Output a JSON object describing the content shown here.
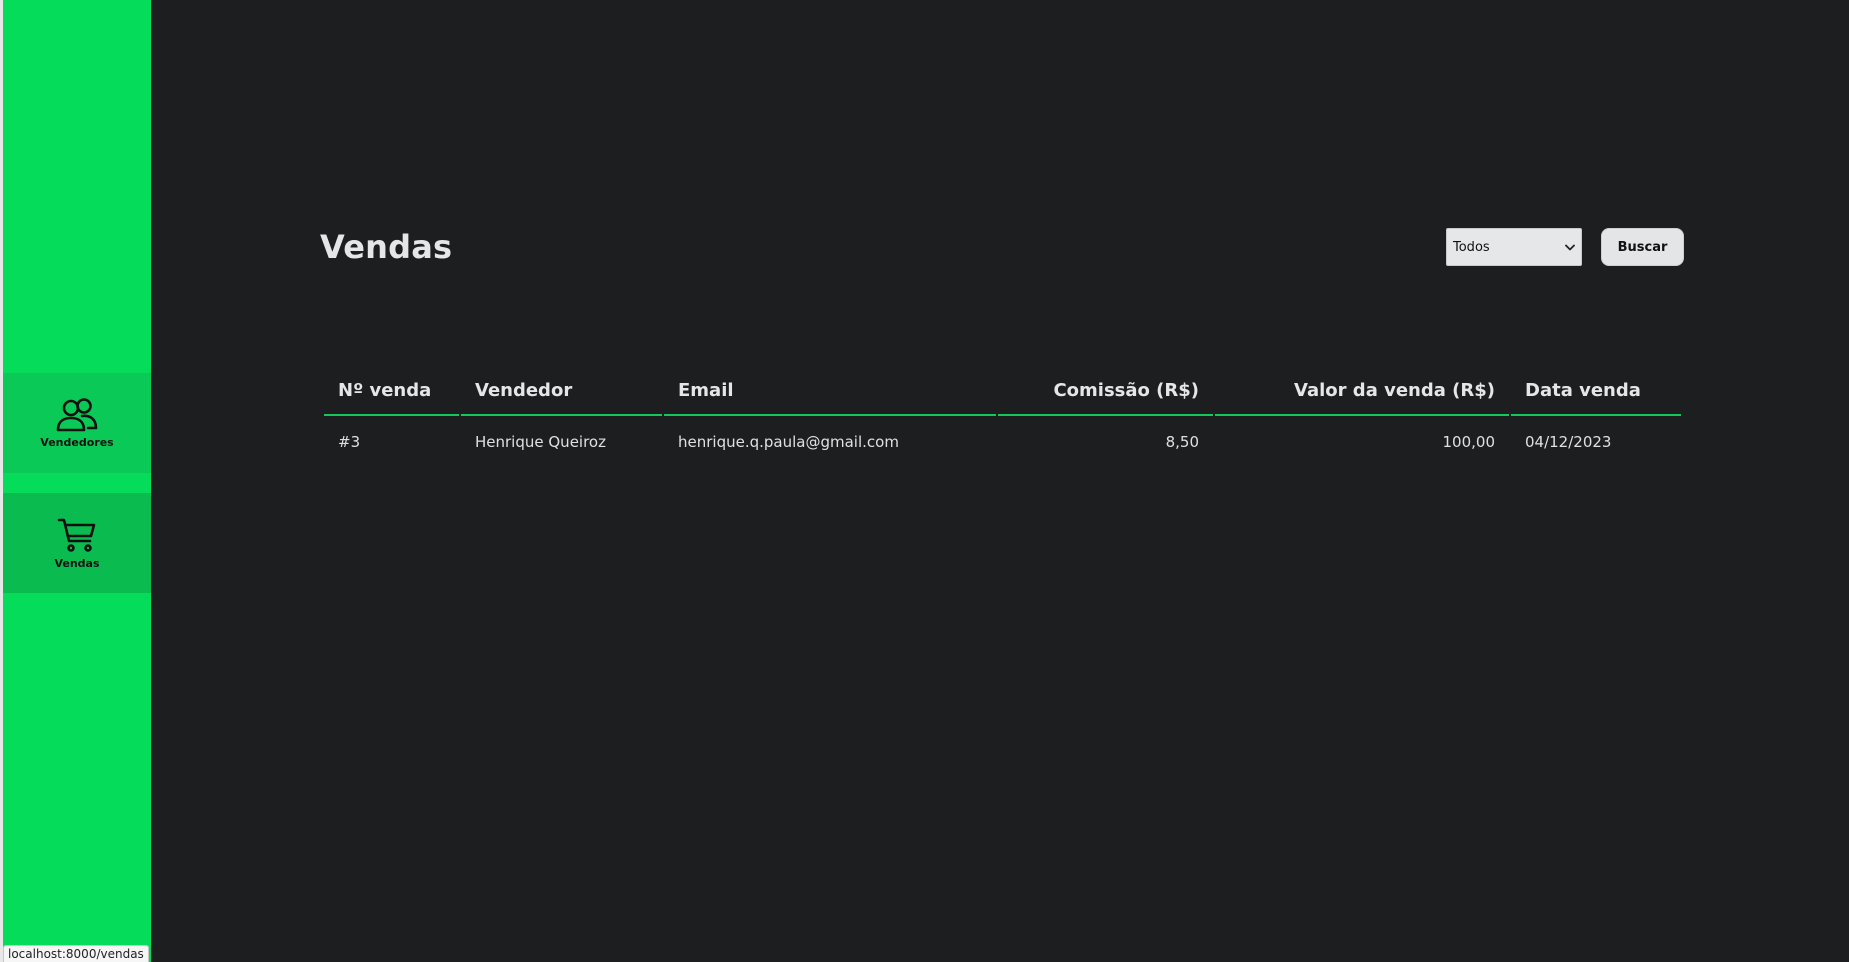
{
  "sidebar": {
    "items": [
      {
        "label": "Vendedores",
        "icon": "users-icon"
      },
      {
        "label": "Vendas",
        "icon": "cart-icon"
      }
    ],
    "active": "Vendas"
  },
  "page": {
    "title": "Vendas"
  },
  "filter": {
    "selected": "Todos"
  },
  "search_button": {
    "label": "Buscar"
  },
  "table": {
    "columns": [
      "Nº venda",
      "Vendedor",
      "Email",
      "Comissão (R$)",
      "Valor da venda (R$)",
      "Data venda"
    ],
    "rows": [
      {
        "numero": "#3",
        "vendedor": "Henrique Queiroz",
        "email": "henrique.q.paula@gmail.com",
        "comissao": "8,50",
        "valor": "100,00",
        "data": "04/12/2023"
      }
    ]
  },
  "status_bar": {
    "url": "localhost:8000/vendas"
  },
  "colors": {
    "sidebar": "#05dc5a",
    "background": "#1d1e20",
    "accent_line": "#15c75a"
  }
}
